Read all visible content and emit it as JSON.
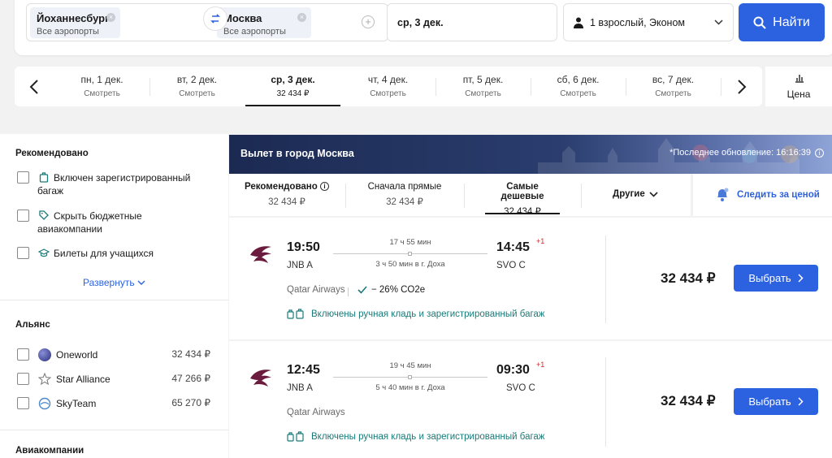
{
  "search": {
    "from_city": "Йоханнесбург",
    "from_sub": "Все аэропорты",
    "to_city": "Москва",
    "to_sub": "Все аэропорты",
    "date": "ср, 3 дек.",
    "passengers": "1 взрослый, Эконом",
    "search_label": "Найти"
  },
  "dates": [
    {
      "day": "пн, 1 дек.",
      "price": "Смотреть"
    },
    {
      "day": "вт, 2 дек.",
      "price": "Смотреть"
    },
    {
      "day": "ср, 3 дек.",
      "price": "32 434 ₽"
    },
    {
      "day": "чт, 4 дек.",
      "price": "Смотреть"
    },
    {
      "day": "пт, 5 дек.",
      "price": "Смотреть"
    },
    {
      "day": "сб, 6 дек.",
      "price": "Смотреть"
    },
    {
      "day": "вс, 7 дек.",
      "price": "Смотреть"
    }
  ],
  "price_chart_label": "Цена",
  "sidebar": {
    "recommended_title": "Рекомендовано",
    "recommended": [
      {
        "label": "Включен зарегистрированный багаж"
      },
      {
        "label": "Скрыть бюджетные авиакомпании"
      },
      {
        "label": "Билеты для учащихся"
      }
    ],
    "expand_label": "Развернуть",
    "alliance_title": "Альянс",
    "alliances": [
      {
        "name": "Oneworld",
        "price": "32 434 ₽"
      },
      {
        "name": "Star Alliance",
        "price": "47 266 ₽"
      },
      {
        "name": "SkyTeam",
        "price": "65 270 ₽"
      }
    ],
    "airlines_title": "Авиакомпании"
  },
  "banner": {
    "title": "Вылет в город Москва",
    "updated": "*Последнее обновление: 16:16:39"
  },
  "sort": {
    "recommended": {
      "label": "Рекомендовано",
      "value": "32 434 ₽"
    },
    "direct": {
      "label": "Сначала прямые",
      "value": "32 434 ₽"
    },
    "cheapest": {
      "label": "Самые дешевые",
      "value": "32 434 ₽"
    },
    "other": "Другие",
    "track": "Следить за ценой"
  },
  "flights": [
    {
      "dep_time": "19:50",
      "dep_code": "JNB A",
      "duration": "17 ч 55 мин",
      "layover": "3 ч 50 мин в г. Доха",
      "arr_time": "14:45",
      "arr_code": "SVO C",
      "plus_day": "+1",
      "airline": "Qatar Airways",
      "co2": "− 26% CO2e",
      "baggage": "Включены ручная кладь и зарегистрированный багаж",
      "price": "32 434 ₽",
      "select": "Выбрать"
    },
    {
      "dep_time": "12:45",
      "dep_code": "JNB A",
      "duration": "19 ч 45 мин",
      "layover": "5 ч 40 мин в г. Доха",
      "arr_time": "09:30",
      "arr_code": "SVO C",
      "plus_day": "+1",
      "airline": "Qatar Airways",
      "baggage": "Включены ручная кладь и зарегистрированный багаж",
      "price": "32 434 ₽",
      "select": "Выбрать"
    }
  ]
}
